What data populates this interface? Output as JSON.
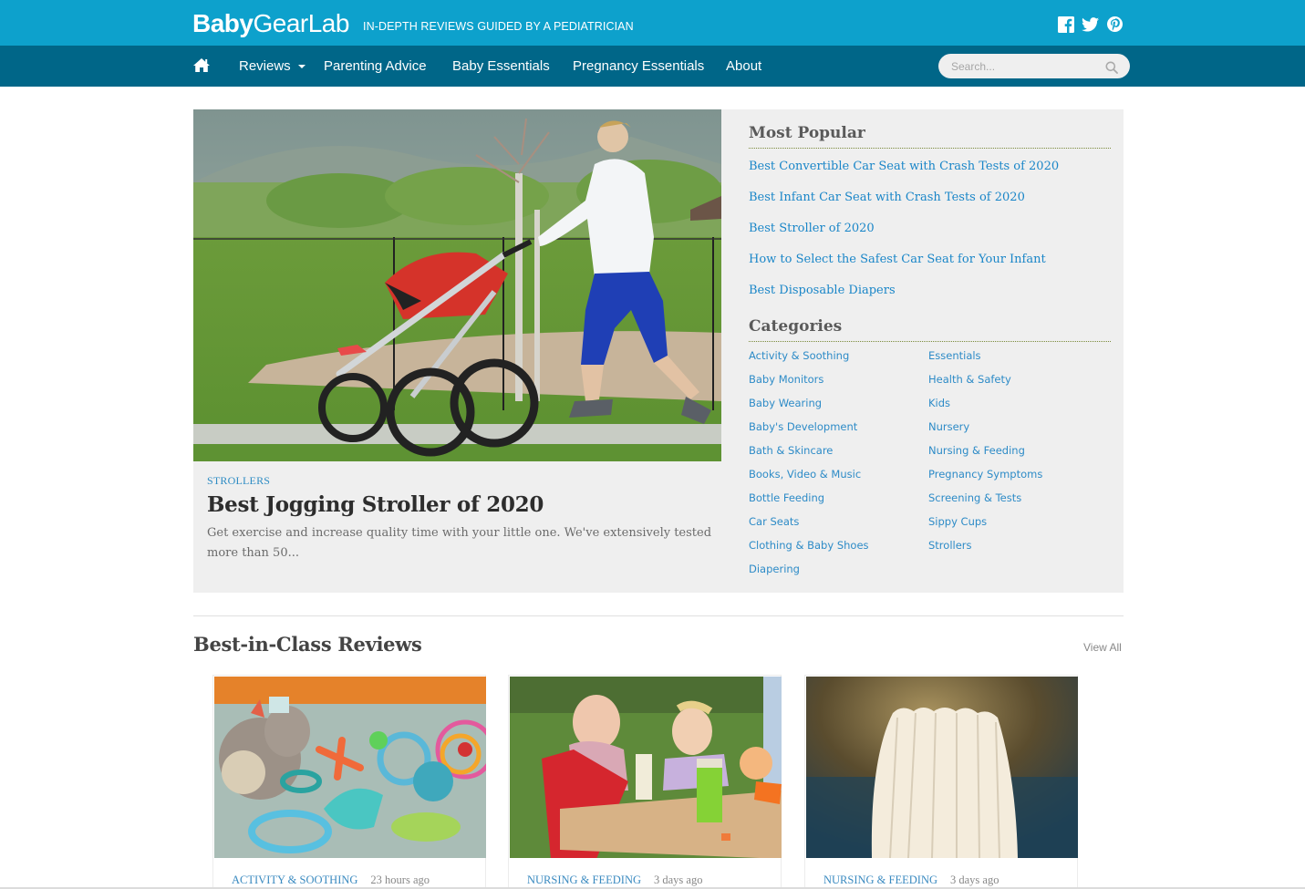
{
  "header": {
    "logo_bold": "Baby",
    "logo_light": "GearLab",
    "tagline": "IN-DEPTH REVIEWS GUIDED BY A PEDIATRICIAN",
    "social": [
      {
        "name": "facebook-icon"
      },
      {
        "name": "twitter-icon"
      },
      {
        "name": "pinterest-icon"
      }
    ]
  },
  "nav": {
    "home_icon": "home-icon",
    "items": [
      {
        "label": "Reviews",
        "has_dropdown": true
      },
      {
        "label": "Parenting Advice"
      },
      {
        "label": "Baby Essentials"
      },
      {
        "label": "Pregnancy Essentials"
      },
      {
        "label": "About"
      }
    ],
    "search": {
      "placeholder": "Search...",
      "value": ""
    }
  },
  "feature": {
    "category": "STROLLERS",
    "title": "Best Jogging Stroller of 2020",
    "description": "Get exercise and increase quality time with your little one. We've extensively tested more than 50...",
    "image_alt": "Woman jogging while pushing a red jogging stroller in a park"
  },
  "sidebar": {
    "popular_heading": "Most Popular",
    "popular": [
      "Best Convertible Car Seat with Crash Tests of 2020",
      "Best Infant Car Seat with Crash Tests of 2020",
      "Best Stroller of 2020",
      "How to Select the Safest Car Seat for Your Infant",
      "Best Disposable Diapers"
    ],
    "categories_heading": "Categories",
    "categories_left": [
      "Activity & Soothing",
      "Baby Monitors",
      "Baby Wearing",
      "Baby's Development",
      "Bath & Skincare",
      "Books, Video & Music",
      "Bottle Feeding",
      "Car Seats",
      "Clothing & Baby Shoes",
      "Diapering"
    ],
    "categories_right": [
      "Essentials",
      "Health & Safety",
      "Kids",
      "Nursery",
      "Nursing & Feeding",
      "Pregnancy Symptoms",
      "Screening & Tests",
      "Sippy Cups",
      "Strollers"
    ]
  },
  "best_in_class": {
    "title": "Best-in-Class Reviews",
    "view_all": "View All",
    "cards": [
      {
        "category": "ACTIVITY & SOOTHING",
        "time": "23 hours ago",
        "image_alt": "Teething toys and plush sloth"
      },
      {
        "category": "NURSING & FEEDING",
        "time": "3 days ago",
        "image_alt": "Toddlers at a table with sippy cup"
      },
      {
        "category": "NURSING & FEEDING",
        "time": "3 days ago",
        "image_alt": "Stack of cloth nursing pads"
      }
    ]
  },
  "colors": {
    "topbar": "#0da1cc",
    "navbar": "#006688",
    "link": "#1a86c8",
    "panel": "#efefef"
  }
}
